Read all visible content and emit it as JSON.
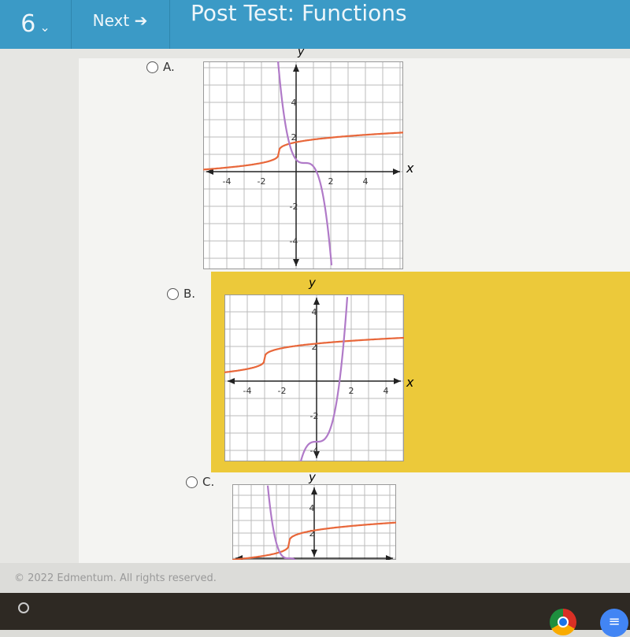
{
  "header": {
    "question_number": "6",
    "next_label": "Next",
    "title": "Post Test: Functions"
  },
  "options": [
    {
      "label": "A.",
      "axis_x": "x",
      "axis_y": "y",
      "ticks_x": [
        "-4",
        "-2",
        "2",
        "4"
      ],
      "ticks_y": [
        "4",
        "2",
        "-2",
        "-4"
      ],
      "selected": true
    },
    {
      "label": "B.",
      "axis_x": "x",
      "axis_y": "y",
      "ticks_x": [
        "-4",
        "-2",
        "2",
        "4"
      ],
      "ticks_y": [
        "4",
        "2",
        "-2",
        "-4"
      ],
      "highlighted": true
    },
    {
      "label": "C.",
      "axis_x": "x",
      "axis_y": "y",
      "ticks_x": [],
      "ticks_y": [
        "4",
        "2"
      ]
    }
  ],
  "colors": {
    "header": "#3b9ac6",
    "highlight": "#ecc93a",
    "curve_orange": "#e8673a",
    "curve_purple": "#b07ac8"
  },
  "footer": {
    "copyright": "© 2022 Edmentum. All rights reserved."
  },
  "taskbar": {
    "icons": [
      "launcher-icon",
      "chrome-icon",
      "docs-icon"
    ]
  }
}
